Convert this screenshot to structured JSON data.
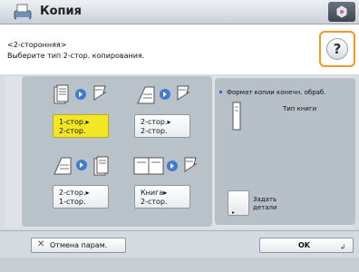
{
  "titlebar": {
    "title": "Копия",
    "app_icon": "copier-icon",
    "corner_icon": "status-monitor-icon"
  },
  "hint": {
    "line1": "<2-сторонняя>",
    "line2": "Выберите тип 2-стор. копирования."
  },
  "help": {
    "label": "?"
  },
  "options": [
    {
      "line1": "1-стор.▸",
      "line2": "2-стор.",
      "selected": true
    },
    {
      "line1": "2-стор.▸",
      "line2": "2-стор.",
      "selected": false
    },
    {
      "line1": "2-стор.▸",
      "line2": "1-стор.",
      "selected": false
    },
    {
      "line1": "Книга▸",
      "line2": "2-стор.",
      "selected": false
    }
  ],
  "format": {
    "label": "Формат копии конечн. обраб.",
    "value": "Тип книги"
  },
  "details": {
    "line1": "Задать",
    "line2": "детали",
    "arrow": "▸"
  },
  "footer": {
    "cancel_label": "Отмена парам.",
    "cancel_icon": "✕",
    "ok_label": "OK",
    "ok_icon": "↲"
  },
  "colors": {
    "accent_highlight": "#f19a21",
    "selected_option": "#f2e627"
  }
}
